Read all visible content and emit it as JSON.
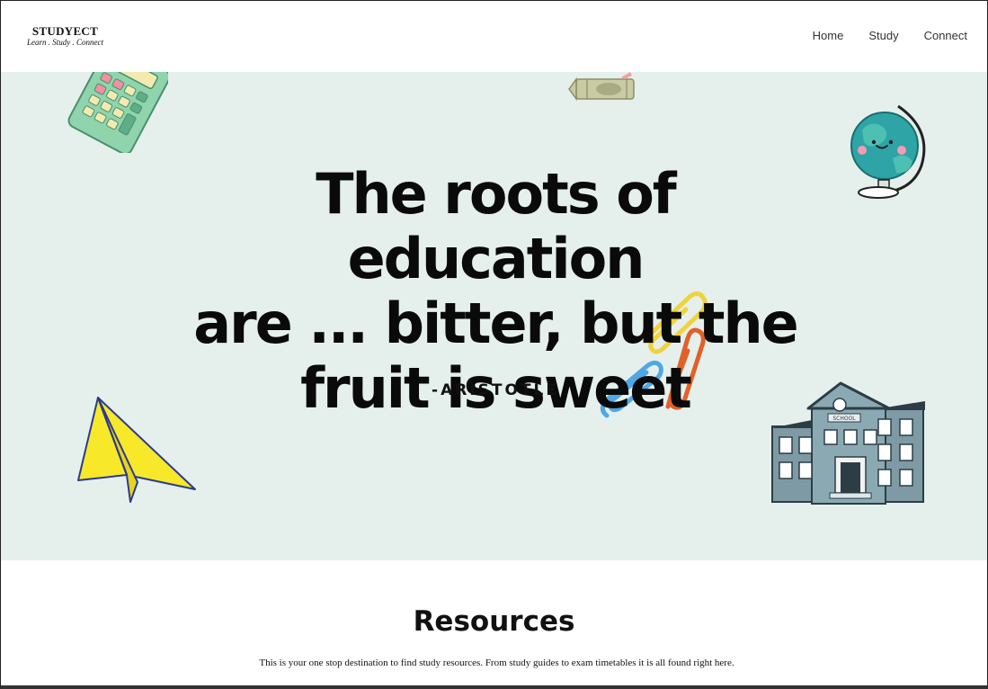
{
  "header": {
    "brand_name": "STUDYECT",
    "brand_tagline": "Learn . Study . Connect",
    "nav": [
      {
        "label": "Home"
      },
      {
        "label": "Study"
      },
      {
        "label": "Connect"
      }
    ]
  },
  "hero": {
    "quote_lines": [
      "The roots of education",
      "are ... bitter, but the",
      "fruit is sweet"
    ],
    "author": "-ARISTOTLE",
    "background_color": "#e5f0ec",
    "illustrations": [
      "calculator-icon",
      "crayon-icon",
      "globe-icon",
      "paper-clips-icon",
      "paper-plane-icon",
      "school-building-icon"
    ]
  },
  "resources": {
    "title": "Resources",
    "description": "This is your one stop destination to find study resources. From study guides to exam timetables it is all found right here."
  }
}
